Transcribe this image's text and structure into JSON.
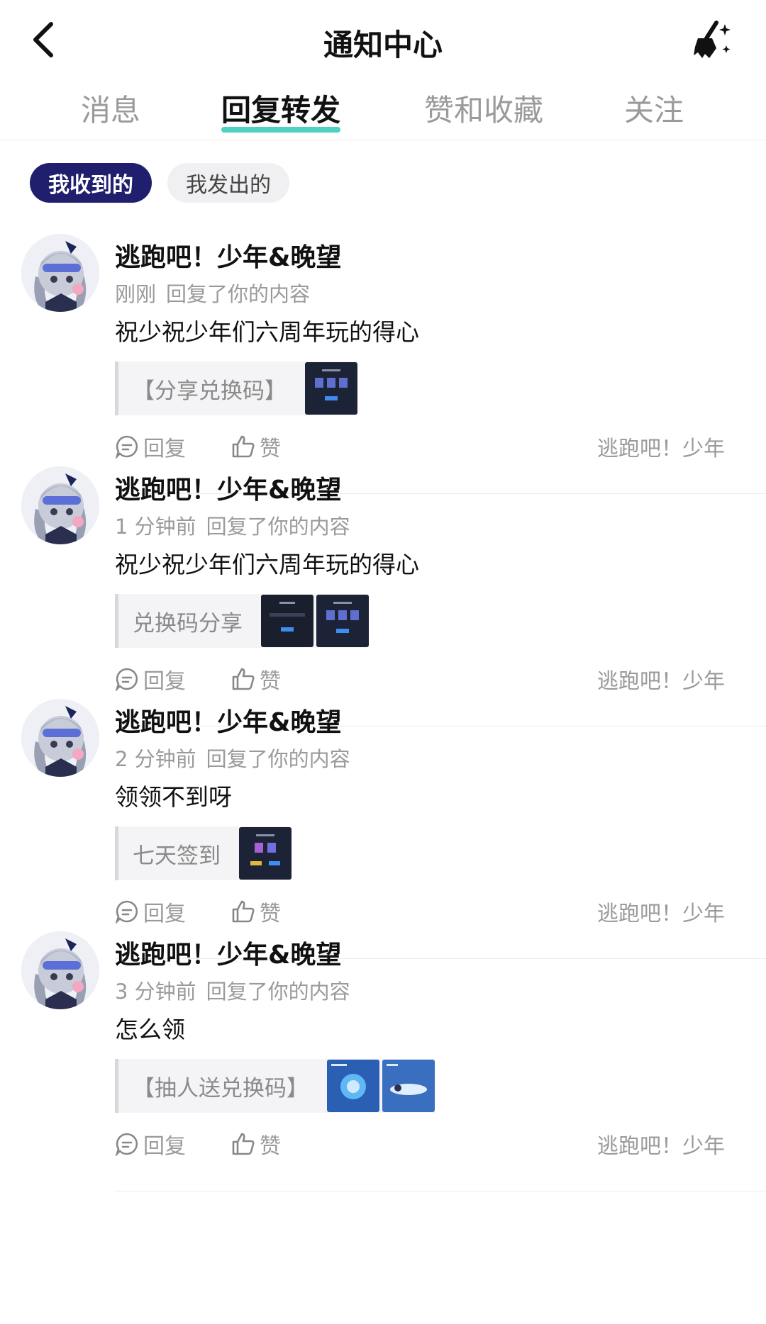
{
  "header": {
    "title": "通知中心",
    "back_icon": "chevron-left-icon",
    "clean_icon": "broom-sparkle-icon"
  },
  "tabs": [
    {
      "label": "消息",
      "active": false
    },
    {
      "label": "回复转发",
      "active": true
    },
    {
      "label": "赞和收藏",
      "active": false
    },
    {
      "label": "关注",
      "active": false
    }
  ],
  "filters": {
    "received": "我收到的",
    "sent": "我发出的"
  },
  "colors": {
    "accent_underline": "#4fd1bf",
    "pill_active_bg": "#1f1f6e",
    "muted_text": "#9a9a9a"
  },
  "actions": {
    "reply_label": "回复",
    "like_label": "赞"
  },
  "notifications": [
    {
      "name": "逃跑吧！少年&晚望",
      "time": "刚刚",
      "action_text": "回复了你的内容",
      "reply": "祝少祝少年们六周年玩的得心",
      "quote": "【分享兑换码】",
      "source": "逃跑吧！少年"
    },
    {
      "name": "逃跑吧！少年&晚望",
      "time": "1 分钟前",
      "action_text": "回复了你的内容",
      "reply": "祝少祝少年们六周年玩的得心",
      "quote": "兑换码分享",
      "source": "逃跑吧！少年"
    },
    {
      "name": "逃跑吧！少年&晚望",
      "time": "2 分钟前",
      "action_text": "回复了你的内容",
      "reply": "领领不到呀",
      "quote": "七天签到",
      "source": "逃跑吧！少年"
    },
    {
      "name": "逃跑吧！少年&晚望",
      "time": "3 分钟前",
      "action_text": "回复了你的内容",
      "reply": "怎么领",
      "quote": "【抽人送兑换码】",
      "source": "逃跑吧！少年"
    }
  ]
}
